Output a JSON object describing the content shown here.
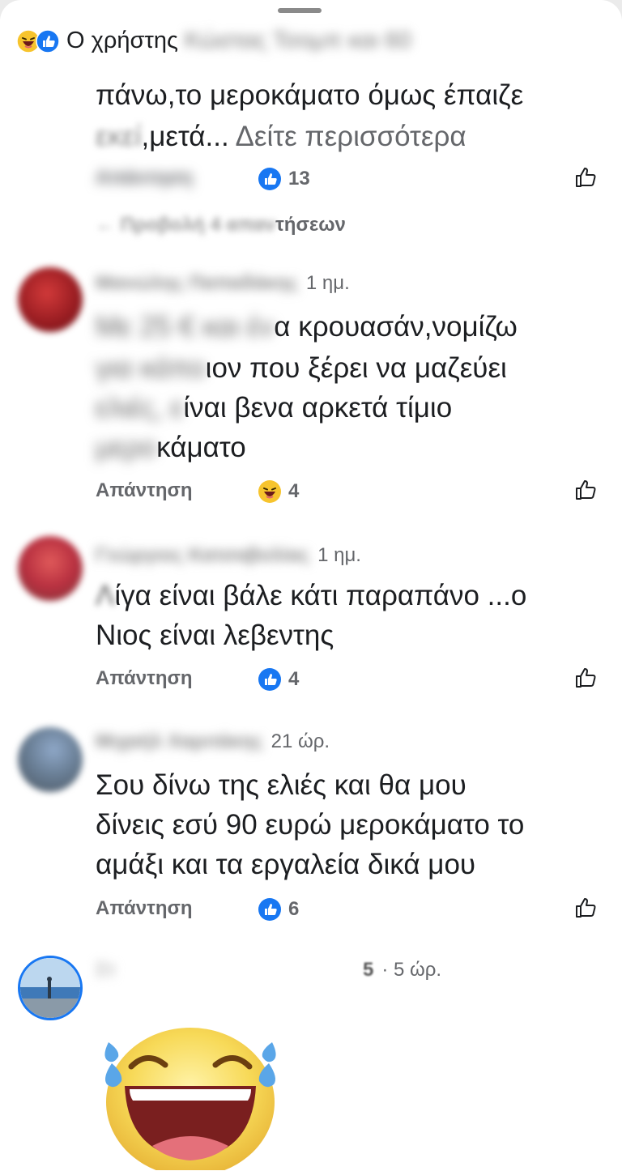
{
  "header": {
    "reply_context_prefix": "Ο χρήστης",
    "reply_context_blurred": "Κώστας Τσομπ και 60"
  },
  "first_comment": {
    "line1": "πάνω,το μεροκάματο όμως έπαιζε",
    "line2_blurred": "εκεί",
    "line2": ",μετά...",
    "see_more": "Δείτε περισσότερα",
    "reply_label_blurred": "Απάντηση",
    "reaction_icon": "like-icon",
    "reaction_count": "13"
  },
  "previous_replies": {
    "blurred_part": "← Προβολή 4 απαν",
    "visible_part": "τήσεων"
  },
  "comments": [
    {
      "name_blurred": "Μανώλης Παπαδάκης",
      "time": "1 ημ.",
      "lines": [
        {
          "blurred": "Με 25 € και έν",
          "visible": "α κρουασάν,νομίζω"
        },
        {
          "blurred": "για κάπο",
          "visible": "ιον που ξέρει να μαζεύει"
        },
        {
          "blurred": "ελιές, ε",
          "visible": "ίναι βενα αρκετά τίμιο"
        },
        {
          "blurred": "μερο",
          "visible": "κάματο"
        }
      ],
      "reply_label": "Απάντηση",
      "reaction_icon": "haha-icon",
      "reaction_count": "4"
    },
    {
      "name_blurred": "Γεώργιος Κατσαβολίας",
      "time": "1 ημ.",
      "lines": [
        {
          "blurred": "Λ",
          "visible": "ίγα είναι βάλε κάτι παραπάνο ...ο"
        },
        {
          "blurred": "",
          "visible": "Νιος είναι λεβεντης"
        }
      ],
      "reply_label": "Απάντηση",
      "reaction_icon": "like-icon",
      "reaction_count": "4"
    },
    {
      "name_blurred": "Μιχαήλ Χαριτάκης",
      "time": "21 ώρ.",
      "lines": [
        {
          "blurred": "",
          "visible": "Σου δίνω της ελιές και θα μου"
        },
        {
          "blurred": "",
          "visible": "δίνεις εσύ 90 ευρώ μεροκάματο το"
        },
        {
          "blurred": "",
          "visible": "αμάξι και τα εργαλεία δικά μου"
        }
      ],
      "reply_label": "Απάντηση",
      "reaction_icon": "like-icon",
      "reaction_count": "6"
    }
  ],
  "last_comment": {
    "name_blurred": "Στ",
    "name_tail": "5",
    "time": "· 5 ώρ.",
    "sticker": "laughing-crying-emoji"
  },
  "colors": {
    "like_blue": "#1877f2",
    "secondary_text": "#65676b",
    "primary_text": "#1c1e21",
    "haha_yellow": "#f7c42d"
  }
}
